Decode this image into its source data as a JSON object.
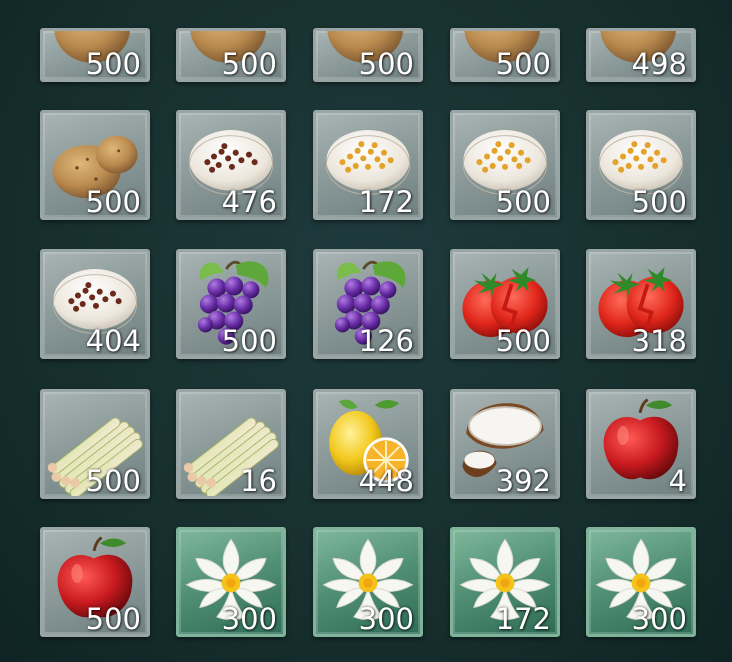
{
  "inventory": {
    "rows": [
      [
        {
          "item": "potato-icon",
          "qty": "500"
        },
        {
          "item": "potato-icon",
          "qty": "500"
        },
        {
          "item": "potato-icon",
          "qty": "500"
        },
        {
          "item": "potato-icon",
          "qty": "500"
        },
        {
          "item": "potato-icon",
          "qty": "498"
        }
      ],
      [
        {
          "item": "potato-icon",
          "qty": "500"
        },
        {
          "item": "red-seeds-plate-icon",
          "qty": "476"
        },
        {
          "item": "yellow-seeds-plate-icon",
          "qty": "172"
        },
        {
          "item": "yellow-seeds-plate-icon",
          "qty": "500"
        },
        {
          "item": "yellow-seeds-plate-icon",
          "qty": "500"
        }
      ],
      [
        {
          "item": "red-seeds-plate-icon",
          "qty": "404"
        },
        {
          "item": "grapes-icon",
          "qty": "500"
        },
        {
          "item": "grapes-icon",
          "qty": "126"
        },
        {
          "item": "tomato-icon",
          "qty": "500"
        },
        {
          "item": "tomato-icon",
          "qty": "318"
        }
      ],
      [
        {
          "item": "lemongrass-icon",
          "qty": "500"
        },
        {
          "item": "lemongrass-icon",
          "qty": "16"
        },
        {
          "item": "lemon-icon",
          "qty": "448"
        },
        {
          "item": "coconut-icon",
          "qty": "392"
        },
        {
          "item": "apple-icon",
          "qty": "4"
        }
      ],
      [
        {
          "item": "apple-icon",
          "qty": "500"
        },
        {
          "item": "water-lily-icon",
          "qty": "300",
          "rarity": "green"
        },
        {
          "item": "water-lily-icon",
          "qty": "300",
          "rarity": "green"
        },
        {
          "item": "water-lily-icon",
          "qty": "172",
          "rarity": "green"
        },
        {
          "item": "water-lily-icon",
          "qty": "300",
          "rarity": "green"
        }
      ]
    ]
  },
  "colors": {
    "background": "#17302f",
    "slot_common": "#8d9b9b",
    "slot_green": "#4f8e74",
    "quantity_text": "#ffffff"
  }
}
